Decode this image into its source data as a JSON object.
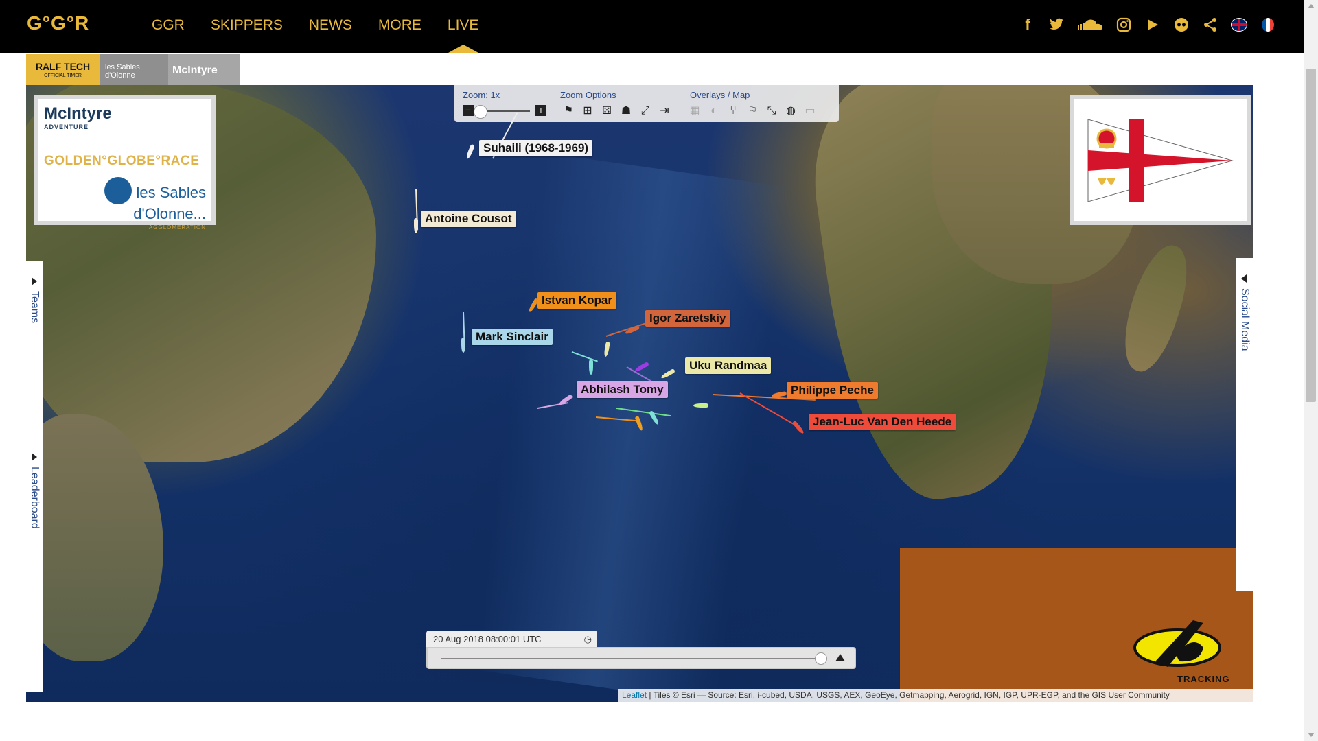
{
  "nav": {
    "logo": "G°G°R",
    "links": [
      "GGR",
      "SKIPPERS",
      "NEWS",
      "MORE",
      "LIVE"
    ],
    "active": "LIVE",
    "icons": [
      "facebook-icon",
      "twitter-icon",
      "soundcloud-icon",
      "instagram-icon",
      "youtube-icon",
      "flickr-icon",
      "share-icon",
      "uk-flag-icon",
      "fr-flag-icon"
    ]
  },
  "sponsors": {
    "ralf_name": "RALF TECH",
    "ralf_sub": "OFFICIAL TIMER",
    "sables": "les Sables d'Olonne",
    "mcintyre": "McIntyre"
  },
  "logo_panel": {
    "mcintyre": "McIntyre",
    "mcintyre_sub": "ADVENTURE",
    "ggr": "GOLDEN°GLOBE°RACE",
    "sables": "les Sables d'Olonne...",
    "sables_sub": "AGGLOMERATION"
  },
  "toolbar": {
    "zoom_label": "Zoom: 1x",
    "zoom_options_label": "Zoom Options",
    "overlays_label": "Overlays / Map",
    "zoom_out": "−",
    "zoom_in": "+"
  },
  "side_tabs": {
    "teams": "Teams",
    "leaderboard": "Leaderboard",
    "social": "Social Media"
  },
  "boats": [
    {
      "name": "Suhaili (1968-1969)",
      "color": "#f2f2f2"
    },
    {
      "name": "Antoine Cousot",
      "color": "#f3ead5"
    },
    {
      "name": "Istvan Kopar",
      "color": "#f0901a"
    },
    {
      "name": "Igor Zaretskiy",
      "color": "#d2653c"
    },
    {
      "name": "Mark Sinclair",
      "color": "#a9d6e9"
    },
    {
      "name": "Uku Randmaa",
      "color": "#ece8a8"
    },
    {
      "name": "Abhilash Tomy",
      "color": "#d8a6e4"
    },
    {
      "name": "Philippe Peche",
      "color": "#ef7b2e"
    },
    {
      "name": "Jean-Luc Van Den Heede",
      "color": "#ef4b3a"
    }
  ],
  "timeline": {
    "datetime": "20 Aug 2018 08:00:01 UTC"
  },
  "tracking_logo": "TRACKING",
  "attribution": {
    "leaflet": "Leaflet",
    "tiles": " | Tiles © Esri — Source: Esri, i-cubed, USDA, USGS, AEX, GeoEye, Getmapping, Aerogrid, IGN, IGP, UPR-EGP, and the GIS User Community"
  }
}
